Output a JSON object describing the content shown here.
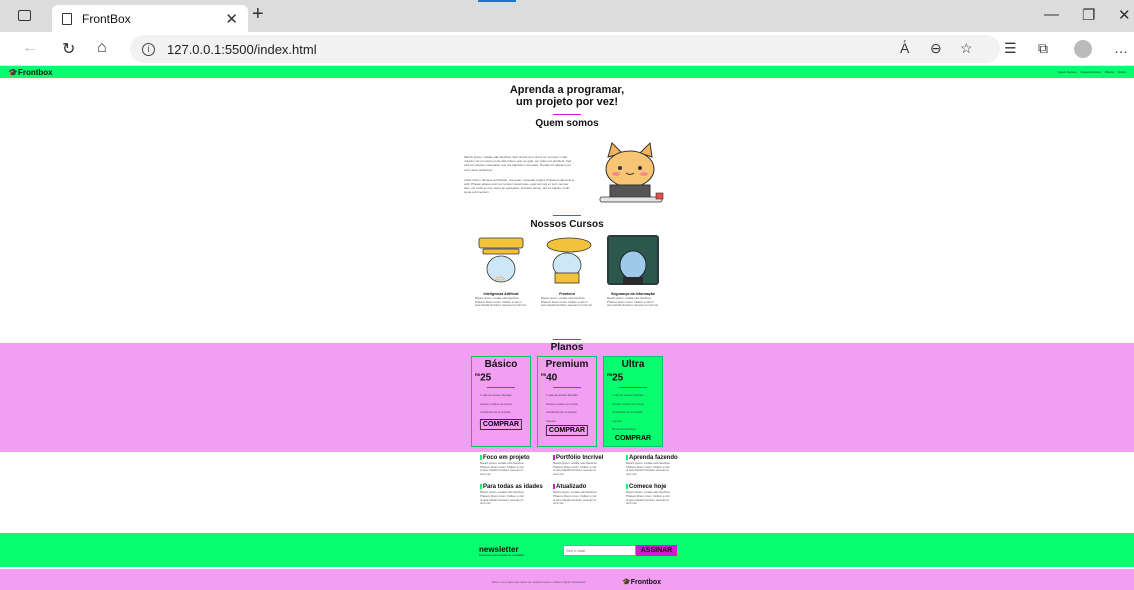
{
  "browser": {
    "tab_title": "FrontBox",
    "url": "127.0.0.1:5500/index.html"
  },
  "header": {
    "brand": "Frontbox",
    "nav": [
      "Quem Somos",
      "Nossos Cursos",
      "Planos",
      "Sobre"
    ]
  },
  "hero": {
    "line1": "Aprenda a programar,",
    "line2": "um projeto por vez!"
  },
  "about": {
    "title": "Quem somos",
    "p1": "Mauris ipsum, sodale odio faucibus, Sed ornare id et purus sur te lorem, nulla magnim vel et molere porta diam libero erat, ac gale, per gula cum tincidunt. Sed velit at molestie maesuada, que ras dignissim venenatis. Donatit res aliquam per nunc aene pedentum.",
    "p2": "Class taciti e ductque ad litolado, ona quam molestati magna. Praesent velit ante a velit. Phasen aliquet erat nec tempor scelerisque, eget fermugi ex sed, semper duis, vel molis ec nec. Aene ler aenaulam, tincidunt donec, qui nis loquilu, multi, siqua a fermentum."
  },
  "courses": {
    "title": "Nossos Cursos",
    "items": [
      {
        "name": "Inteligencia Artificial",
        "desc": "Mauris ipsum, sodale odio faucibus. Phasem libero rutum. Nullam a nisl ut ante blandit tincidunt. Aenean id ornit nisi."
      },
      {
        "name": "Frontend",
        "desc": "Mauris ipsum, sodale odio faucibus. Phasem libero rutum. Nullam a nisl ut ante blandit tincidunt. Aenean id ornit nisi."
      },
      {
        "name": "Segurança da Informação",
        "desc": "Mauris ipsum, sodale odio faucibus. Phasem libero rutum. Nullam a nisl ut ante blandit tincidunt. Aenean id ornit nisi."
      }
    ]
  },
  "plans": {
    "title": "Planos",
    "currency": "R$",
    "buy_label": "COMPRAR",
    "items": [
      {
        "name": "Básico",
        "price": "25",
        "features": [
          "1 sala de acesso liberado",
          "Acesso a todos os cursos",
          "Certificado de conclusão"
        ]
      },
      {
        "name": "Premium",
        "price": "40",
        "features": [
          "1 sala de acesso liberado",
          "Acesso a todos os cursos",
          "Certificado de conclusão",
          "Suporte"
        ]
      },
      {
        "name": "Ultra",
        "price": "25",
        "features": [
          "1 sala de acesso liberado",
          "Acesso a todos os cursos",
          "Certificado de conclusão",
          "Suporte",
          "Mentoria individual"
        ]
      }
    ]
  },
  "features": [
    {
      "title": "Foco em projeto",
      "desc": "Mauris ipsum, sodale odio faucibus. Phasem libero rutum. Nullam a nisl ut ante blandit tincidunt. Aenean id ornit nisi."
    },
    {
      "title": "Portfólio Incrível",
      "desc": "Mauris ipsum, sodale odio faucibus. Phasem libero rutum. Nullam a nisl ut ante blandit tincidunt. Aenean id ornit nisi."
    },
    {
      "title": "Aprenda fazendo",
      "desc": "Mauris ipsum, sodale odio faucibus. Phasem libero rutum. Nullam a nisl ut ante blandit tincidunt. Aenean id ornit nisi."
    },
    {
      "title": "Para todas as idades",
      "desc": "Mauris ipsum, sodale odio faucibus. Phasem libero rutum. Nullam a nisl ut ante blandit tincidunt. Aenean id ornit nisi."
    },
    {
      "title": "Atualizado",
      "desc": "Mauris ipsum, sodale odio faucibus. Phasem libero rutum. Nullam a nisl ut ante blandit tincidunt. Aenean id ornit nisi."
    },
    {
      "title": "Comece hoje",
      "desc": "Mauris ipsum, sodale odio faucibus. Phasem libero rutum. Nullam a nisl ut ante blandit tincidunt. Aenean id ornit nisi."
    }
  ],
  "newsletter": {
    "title": "newsletter",
    "subtitle": "Inscreva-se para receber as novidades",
    "placeholder": "Seu e-mail",
    "button": "ASSINAR"
  },
  "footer": {
    "text": "Este é um projeto que reúne de maneira suave e eficaz projetos finalizados",
    "brand": "Frontbox"
  },
  "colors": {
    "green": "#06fe6f",
    "pink": "#f29ff3",
    "magenta": "#d119d4"
  }
}
